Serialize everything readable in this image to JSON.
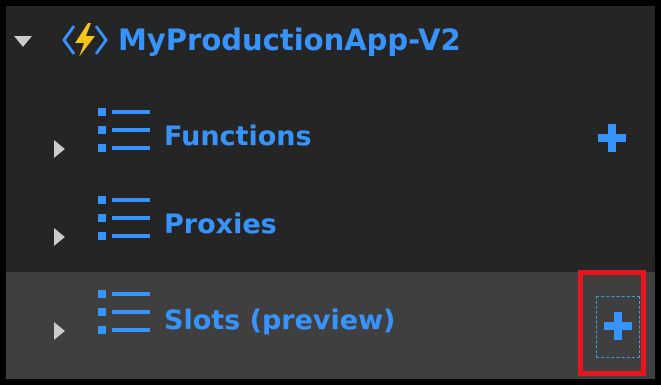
{
  "tree": {
    "root": {
      "label": "MyProductionApp-V2",
      "icon": "function-app-icon",
      "expanded": true
    },
    "items": [
      {
        "label": "Functions",
        "icon": "list-icon",
        "expanded": false,
        "add_button": true,
        "selected": false
      },
      {
        "label": "Proxies",
        "icon": "list-icon",
        "expanded": false,
        "add_button": false,
        "selected": false
      },
      {
        "label": "Slots (preview)",
        "icon": "list-icon",
        "expanded": false,
        "add_button": true,
        "selected": true,
        "highlighted": true
      }
    ]
  },
  "colors": {
    "background": "#252526",
    "selected_row": "#3f3f40",
    "accent_blue": "#3794ff",
    "highlight_red": "#e8141e",
    "bolt_yellow": "#f5c518"
  }
}
